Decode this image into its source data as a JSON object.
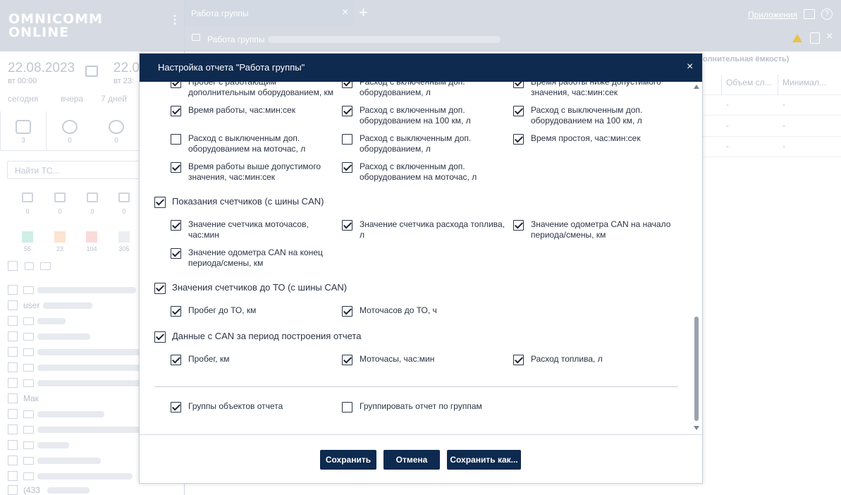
{
  "app": {
    "logo_line1": "OMNICOMM",
    "logo_line2": "ONLINE",
    "kebab": "⋮"
  },
  "period": {
    "date_from": "22.08.2023",
    "time_from": "вт 00:00",
    "date_to": "22.0",
    "time_to": "вт 23:",
    "quick": [
      "сегодня",
      "вчера",
      "7 дней"
    ]
  },
  "sidebar": {
    "tab_counts": [
      "3",
      "0",
      "0"
    ],
    "search_placeholder": "Найти ТС...",
    "stat_counts": [
      "0",
      "0",
      "0",
      "0"
    ],
    "status_counts": [
      "55",
      "23",
      "104",
      "305"
    ],
    "status_colors": [
      "#cfeee6",
      "#fde3d2",
      "#fbdada",
      "#eceef1"
    ],
    "list_items": [
      "user",
      "Мак",
      "(433"
    ]
  },
  "topbar": {
    "tab_label": "Работа группы",
    "tab_close": "×",
    "tab_add": "+",
    "apps_link": "Приложения",
    "help": "?",
    "report_title": "Работа группы",
    "close": "×"
  },
  "grid": {
    "header": "олнительная ёмкость)",
    "col1": "Объем сл...",
    "col2": "Минимал...",
    "dash": "-"
  },
  "modal": {
    "title": "Настройка отчета \"Работа группы\"",
    "close": "×",
    "options_top": [
      {
        "label": "Пробег с работающим дополнительным оборудованием, км",
        "checked": true
      },
      {
        "label": "Расход с включенным доп. оборудованием, л",
        "checked": true
      },
      {
        "label": "Время работы ниже допустимого значения, час:мин:сек",
        "checked": true
      },
      {
        "label": "Время работы, час:мин:сек",
        "checked": true
      },
      {
        "label": "Расход с включенным доп. оборудованием на 100 км, л",
        "checked": true
      },
      {
        "label": "Расход с выключенным доп. оборудованием на 100 км, л",
        "checked": true
      },
      {
        "label": "Расход с выключенным доп. оборудованием на моточас, л",
        "checked": false
      },
      {
        "label": "Расход с выключенным доп. оборудованием, л",
        "checked": false
      },
      {
        "label": "Время простоя, час:мин:сек",
        "checked": true
      },
      {
        "label": "Время работы выше допустимого значения, час:мин:сек",
        "checked": true
      },
      {
        "label": "Расход с включенным доп. оборудованием на моточас, л",
        "checked": true
      }
    ],
    "section_can": {
      "label": "Показания счетчиков (с шины CAN)",
      "checked": true,
      "options": [
        {
          "label": "Значение счетчика моточасов, час:мин",
          "checked": true
        },
        {
          "label": "Значение счетчика расхода топлива, л",
          "checked": true
        },
        {
          "label": "Значение одометра CAN на начало периода/смены, км",
          "checked": true
        },
        {
          "label": "Значение одометра CAN на конец периода/смены, км",
          "checked": true
        }
      ]
    },
    "section_to": {
      "label": "Значения счетчиков до ТО (с шины CAN)",
      "checked": true,
      "options": [
        {
          "label": "Пробег до ТО, км",
          "checked": true
        },
        {
          "label": "Моточасов до ТО, ч",
          "checked": true
        }
      ]
    },
    "section_period": {
      "label": "Данные с CAN за период построения отчета",
      "checked": true,
      "options": [
        {
          "label": "Пробег, км",
          "checked": true
        },
        {
          "label": "Моточасы, час:мин",
          "checked": true
        },
        {
          "label": "Расход топлива, л",
          "checked": true
        }
      ]
    },
    "bottom_options": [
      {
        "label": "Группы объектов отчета",
        "checked": true
      },
      {
        "label": "Группировать отчет по группам",
        "checked": false
      }
    ],
    "buttons": {
      "save": "Сохранить",
      "cancel": "Отмена",
      "save_as": "Сохранить как..."
    }
  }
}
